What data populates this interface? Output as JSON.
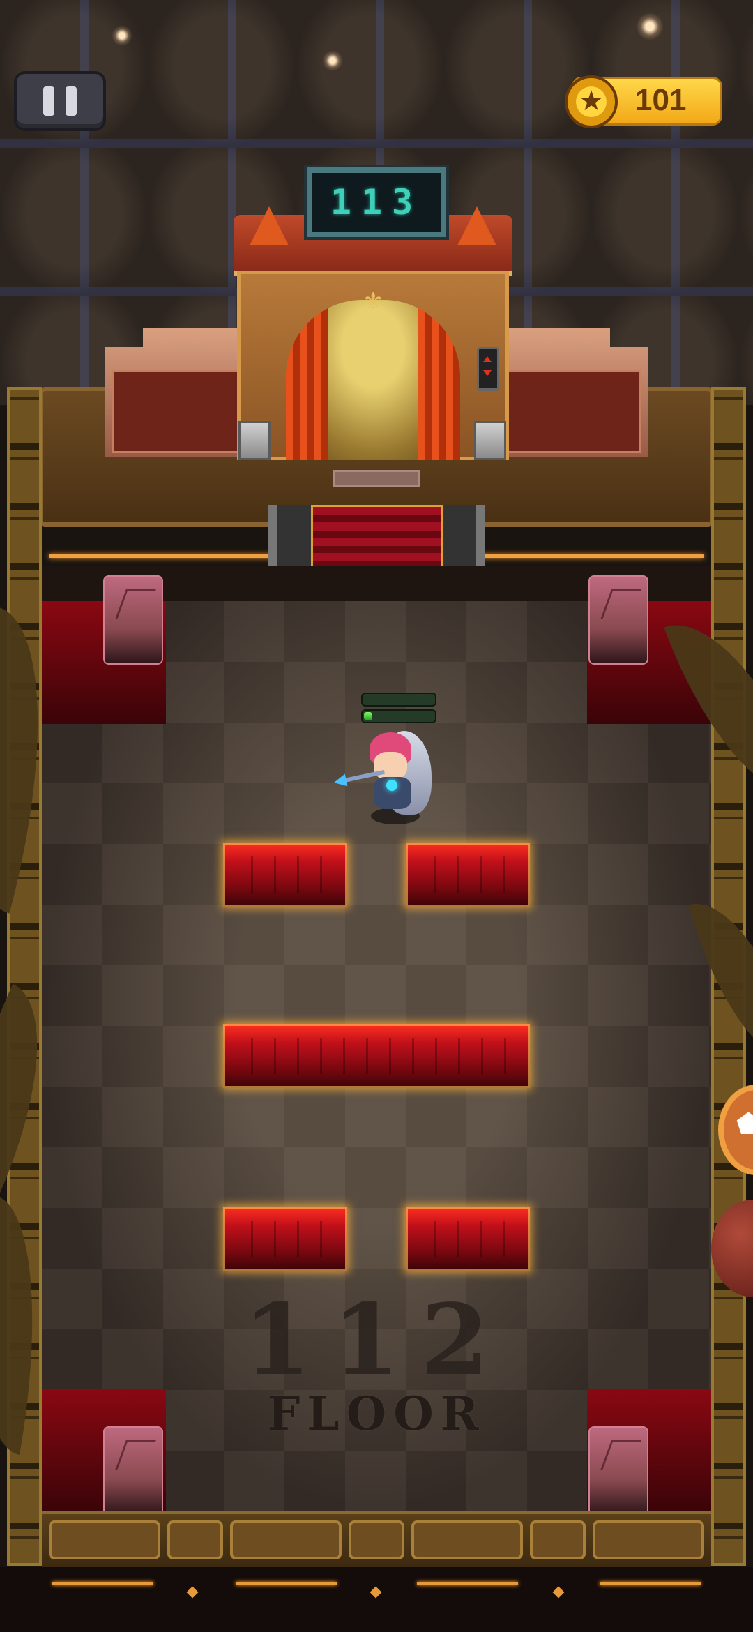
{
  "hud": {
    "coins": "101",
    "pause_icon": "pause-icon",
    "coin_icon": "star-coin-icon"
  },
  "elevator": {
    "display_number": "113"
  },
  "floor": {
    "number": "112",
    "label": "FLOOR"
  },
  "player": {
    "health_fraction": 0.12
  },
  "colors": {
    "lava": "#c0101a",
    "coin": "#ffc930",
    "display_text": "#3ed0b8"
  }
}
